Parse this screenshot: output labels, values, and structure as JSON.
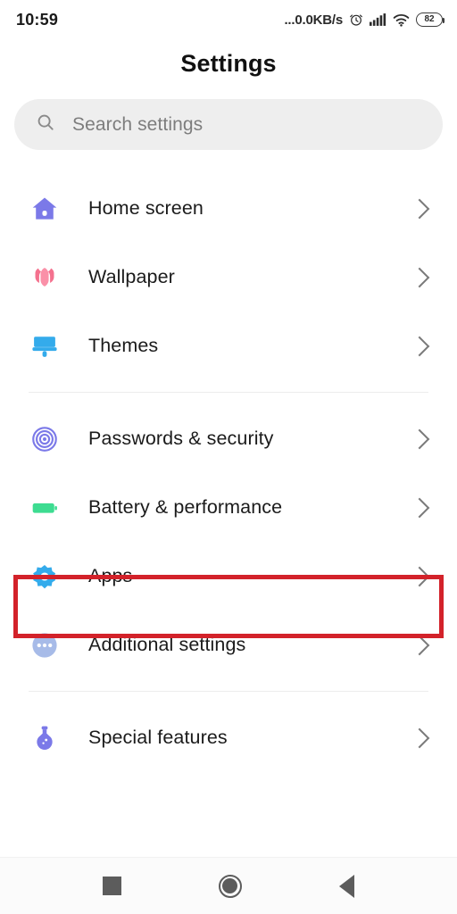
{
  "status_bar": {
    "clock": "10:59",
    "network_speed": "...0.0KB/s",
    "alarm_icon": "alarm-clock-icon",
    "signal_icon": "cellular-signal-icon",
    "wifi_icon": "wifi-icon",
    "battery_level": "82"
  },
  "header": {
    "title": "Settings"
  },
  "search": {
    "icon": "search-icon",
    "placeholder": "Search settings",
    "value": ""
  },
  "groups": [
    {
      "items": [
        {
          "label": "Home screen",
          "icon": "home-icon",
          "color": "#7b79e8",
          "chevron": "chevron-right-icon"
        },
        {
          "label": "Wallpaper",
          "icon": "flower-icon",
          "color": "#f4718e",
          "chevron": "chevron-right-icon"
        },
        {
          "label": "Themes",
          "icon": "paintbrush-icon",
          "color": "#34abeb",
          "chevron": "chevron-right-icon"
        }
      ]
    },
    {
      "items": [
        {
          "label": "Passwords & security",
          "icon": "fingerprint-icon",
          "color": "#7b79e8",
          "chevron": "chevron-right-icon"
        },
        {
          "label": "Battery & performance",
          "icon": "battery-icon",
          "color": "#3ddc91",
          "chevron": "chevron-right-icon"
        },
        {
          "label": "Apps",
          "icon": "gear-icon",
          "color": "#34abeb",
          "chevron": "chevron-right-icon",
          "highlighted": true
        },
        {
          "label": "Additional settings",
          "icon": "more-dots-icon",
          "color": "#a7bbe8",
          "chevron": "chevron-right-icon"
        }
      ]
    },
    {
      "items": [
        {
          "label": "Special features",
          "icon": "potion-flask-icon",
          "color": "#7b79e8",
          "chevron": "chevron-right-icon"
        }
      ]
    }
  ],
  "highlight": {
    "target_label": "Apps",
    "color": "#d3222a"
  },
  "nav_bar": {
    "recents": "recents-square-icon",
    "home": "home-circle-icon",
    "back": "back-triangle-icon"
  }
}
